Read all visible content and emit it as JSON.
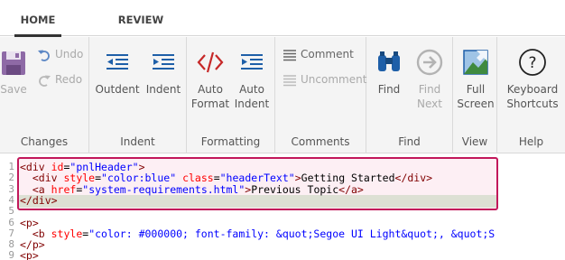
{
  "tabs": [
    {
      "label": "HOME",
      "active": true
    },
    {
      "label": "REVIEW",
      "active": false
    }
  ],
  "ribbon": {
    "changes": {
      "label": "Changes",
      "save": "Save",
      "undo": "Undo",
      "redo": "Redo"
    },
    "indent": {
      "label": "Indent",
      "outdent": "Outdent",
      "indent": "Indent"
    },
    "formatting": {
      "label": "Formatting",
      "auto_format": [
        "Auto",
        "Format"
      ],
      "auto_indent": [
        "Auto",
        "Indent"
      ]
    },
    "comments": {
      "label": "Comments",
      "comment": "Comment",
      "uncomment": "Uncomment"
    },
    "find": {
      "label": "Find",
      "find": "Find",
      "find_next": [
        "Find",
        "Next"
      ]
    },
    "view": {
      "label": "View",
      "full_screen": [
        "Full",
        "Screen"
      ]
    },
    "help": {
      "label": "Help",
      "keyboard_shortcuts": [
        "Keyboard",
        "Shortcuts"
      ]
    }
  },
  "colors": {
    "selection_border": "#c2185b",
    "tag": "#800000",
    "attribute": "#ff0000",
    "value": "#0000ff",
    "icon_blue": "#1e5fa8",
    "icon_red": "#c62828"
  },
  "editor": {
    "lines": [
      {
        "n": "1",
        "parts": [
          [
            "t",
            "<div "
          ],
          [
            "a",
            "id"
          ],
          [
            "x",
            "="
          ],
          [
            "v",
            "\"pnlHeader\""
          ],
          [
            "t",
            ">"
          ]
        ]
      },
      {
        "n": "2",
        "parts": [
          [
            "t",
            "  <div "
          ],
          [
            "a",
            "style"
          ],
          [
            "x",
            "="
          ],
          [
            "v",
            "\"color:blue\""
          ],
          [
            "x",
            " "
          ],
          [
            "a",
            "class"
          ],
          [
            "x",
            "="
          ],
          [
            "v",
            "\"headerText\""
          ],
          [
            "t",
            ">"
          ],
          [
            "x",
            "Getting Started"
          ],
          [
            "t",
            "</div>"
          ]
        ]
      },
      {
        "n": "3",
        "parts": [
          [
            "t",
            "  <a "
          ],
          [
            "a",
            "href"
          ],
          [
            "x",
            "="
          ],
          [
            "v",
            "\"system-requirements.html\""
          ],
          [
            "t",
            ">"
          ],
          [
            "x",
            "Previous Topic"
          ],
          [
            "t",
            "</a>"
          ]
        ]
      },
      {
        "n": "4",
        "parts": [
          [
            "t",
            "</div>"
          ]
        ]
      },
      {
        "n": "5",
        "parts": []
      },
      {
        "n": "6",
        "parts": [
          [
            "t",
            "<p>"
          ]
        ]
      },
      {
        "n": "7",
        "parts": [
          [
            "t",
            "  <b "
          ],
          [
            "a",
            "style"
          ],
          [
            "x",
            "="
          ],
          [
            "v",
            "\"color: #000000; font-family: &quot;Segoe UI Light&quot;, &quot;S"
          ]
        ]
      },
      {
        "n": "8",
        "parts": [
          [
            "t",
            "</p>"
          ]
        ]
      },
      {
        "n": "9",
        "parts": [
          [
            "t",
            "<p>"
          ]
        ]
      }
    ]
  }
}
